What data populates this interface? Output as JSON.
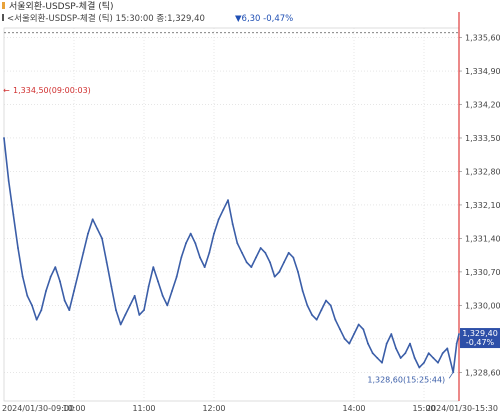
{
  "header": {
    "title": "서울외환-USDSP-체결 (틱)",
    "info_prefix": "<서울외환-USDSP-체결 (틱) 15:30:00 종:1,329,40",
    "info_change": "▼6,30 -0,47%",
    "colors": {
      "down": "#1f4fb4",
      "text": "#333333"
    }
  },
  "chart_data": {
    "type": "line",
    "title": "서울외환-USDSP-체결 (틱)",
    "xlabel": "",
    "ylabel": "",
    "x_range": [
      "2024-01-30 09:00",
      "2024-01-30 15:30"
    ],
    "ylim": [
      1328.0,
      1335.8
    ],
    "y_ticks": [
      "1,335,60",
      "1,334,90",
      "1,334,20",
      "1,333,50",
      "1,332,80",
      "1,332,10",
      "1,331,40",
      "1,330,70",
      "1,330,00",
      "1,329,30",
      "1,328,60"
    ],
    "x_ticks": [
      "2024/01/30-09:00",
      "10:00",
      "11:00",
      "12:00",
      "14:00",
      "15:00",
      "2024/01/30-15:30"
    ],
    "grid": true,
    "series": [
      {
        "color": "#3b5ea8",
        "x": [
          "09:00",
          "09:04",
          "09:08",
          "09:12",
          "09:16",
          "09:20",
          "09:24",
          "09:28",
          "09:32",
          "09:36",
          "09:40",
          "09:44",
          "09:48",
          "09:52",
          "09:56",
          "10:00",
          "10:04",
          "10:08",
          "10:12",
          "10:16",
          "10:20",
          "10:24",
          "10:28",
          "10:32",
          "10:36",
          "10:40",
          "10:44",
          "10:48",
          "10:52",
          "10:56",
          "11:00",
          "11:04",
          "11:08",
          "11:12",
          "11:16",
          "11:20",
          "11:24",
          "11:28",
          "11:32",
          "11:36",
          "11:40",
          "11:44",
          "11:48",
          "11:52",
          "11:56",
          "12:00",
          "12:04",
          "12:08",
          "12:12",
          "12:16",
          "12:20",
          "12:24",
          "12:28",
          "12:32",
          "12:36",
          "12:40",
          "12:44",
          "12:48",
          "12:52",
          "12:56",
          "13:00",
          "13:04",
          "13:08",
          "13:12",
          "13:16",
          "13:20",
          "13:24",
          "13:28",
          "13:32",
          "13:36",
          "13:40",
          "13:44",
          "13:48",
          "13:52",
          "13:56",
          "14:00",
          "14:04",
          "14:08",
          "14:12",
          "14:16",
          "14:20",
          "14:24",
          "14:28",
          "14:32",
          "14:36",
          "14:40",
          "14:44",
          "14:48",
          "14:52",
          "14:56",
          "15:00",
          "15:04",
          "15:08",
          "15:12",
          "15:16",
          "15:20",
          "15:25",
          "15:28",
          "15:30"
        ],
        "values": [
          1333.5,
          1332.6,
          1331.9,
          1331.2,
          1330.6,
          1330.2,
          1330.0,
          1329.7,
          1329.9,
          1330.3,
          1330.6,
          1330.8,
          1330.5,
          1330.1,
          1329.9,
          1330.3,
          1330.7,
          1331.1,
          1331.5,
          1331.8,
          1331.6,
          1331.4,
          1330.9,
          1330.4,
          1329.9,
          1329.6,
          1329.8,
          1330.0,
          1330.2,
          1329.8,
          1329.9,
          1330.4,
          1330.8,
          1330.5,
          1330.2,
          1330.0,
          1330.3,
          1330.6,
          1331.0,
          1331.3,
          1331.5,
          1331.3,
          1331.0,
          1330.8,
          1331.1,
          1331.5,
          1331.8,
          1332.0,
          1332.2,
          1331.7,
          1331.3,
          1331.1,
          1330.9,
          1330.8,
          1331.0,
          1331.2,
          1331.1,
          1330.9,
          1330.6,
          1330.7,
          1330.9,
          1331.1,
          1331.0,
          1330.7,
          1330.3,
          1330.0,
          1329.8,
          1329.7,
          1329.9,
          1330.1,
          1330.0,
          1329.7,
          1329.5,
          1329.3,
          1329.2,
          1329.4,
          1329.6,
          1329.5,
          1329.2,
          1329.0,
          1328.9,
          1328.8,
          1329.2,
          1329.4,
          1329.1,
          1328.9,
          1329.0,
          1329.2,
          1328.9,
          1328.7,
          1328.8,
          1329.0,
          1328.9,
          1328.8,
          1329.0,
          1329.1,
          1328.6,
          1329.2,
          1329.4
        ]
      }
    ],
    "annotations": {
      "high_label": "1,334,50(09:00:03)",
      "high_value": 1334.5,
      "low_label": "1,328,60(15:25:44)",
      "low_value": 1328.6,
      "last_price_label": "1,329,40",
      "last_change_label": "-0,47%",
      "last_value": 1329.4,
      "prev_close_value": 1335.7
    }
  }
}
